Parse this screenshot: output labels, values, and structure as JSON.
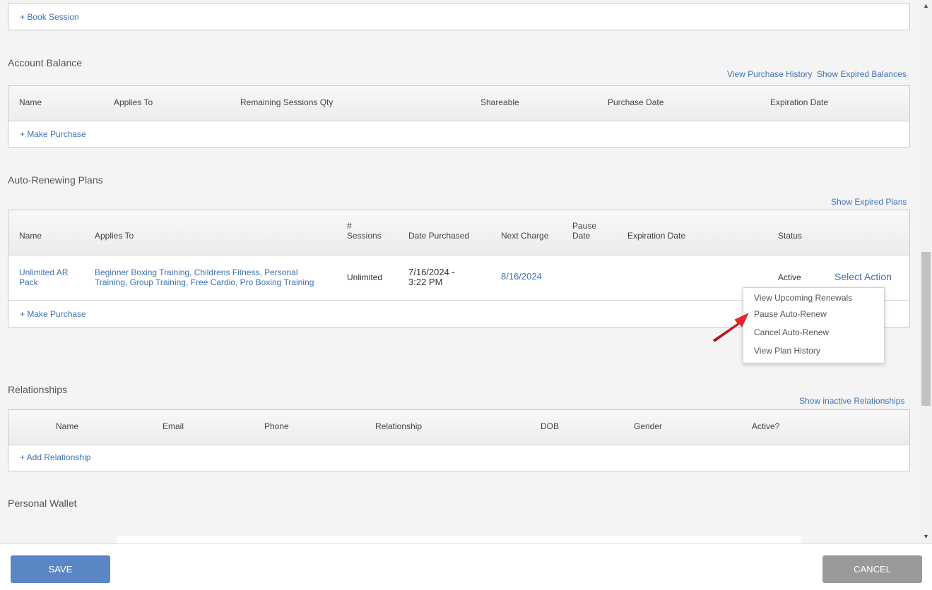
{
  "sessions": {
    "book_session": "+ Book Session"
  },
  "account_balance": {
    "title": "Account Balance",
    "links": {
      "purchase_history": "View Purchase History",
      "expired_balances": "Show Expired Balances"
    },
    "columns": [
      "Name",
      "Applies To",
      "Remaining Sessions Qty",
      "Shareable",
      "Purchase Date",
      "Expiration Date"
    ],
    "make_purchase": "+ Make Purchase"
  },
  "auto_renewing": {
    "title": "Auto-Renewing Plans",
    "links": {
      "expired_plans": "Show Expired Plans"
    },
    "columns": {
      "name": "Name",
      "applies_to": "Applies To",
      "sessions_l1": "#",
      "sessions_l2": "Sessions",
      "date_purchased": "Date Purchased",
      "next_charge": "Next Charge",
      "pause_l1": "Pause",
      "pause_l2": "Date",
      "expiration": "Expiration Date",
      "status": "Status"
    },
    "row": {
      "name_l1": "Unlimited AR",
      "name_l2": "Pack",
      "applies_l1": "Beginner Boxing Training, Childrens Fitness, Personal",
      "applies_l2": "Training, Group Training, Free Cardio, Pro Boxing Training",
      "sessions": "Unlimited",
      "purchased_l1": "7/16/2024 -",
      "purchased_l2": "3:22 PM",
      "next_charge": "8/16/2024",
      "status": "Active",
      "select_action": "Select Action"
    },
    "make_purchase": "+ Make Purchase",
    "menu": [
      "View Upcoming Renewals",
      "Pause Auto-Renew",
      "Cancel Auto-Renew",
      "View Plan History"
    ]
  },
  "relationships": {
    "title": "Relationships",
    "links": {
      "inactive": "Show inactive Relationships"
    },
    "columns": [
      "Name",
      "Email",
      "Phone",
      "Relationship",
      "DOB",
      "Gender",
      "Active?"
    ],
    "add": "+ Add Relationship"
  },
  "wallet": {
    "title": "Personal Wallet"
  },
  "footer": {
    "save": "SAVE",
    "cancel": "CANCEL"
  },
  "colors": {
    "link": "#3e72b4",
    "save_button": "#5b86c5",
    "cancel_button": "#9a9a9a",
    "arrow": "#e0141b"
  }
}
